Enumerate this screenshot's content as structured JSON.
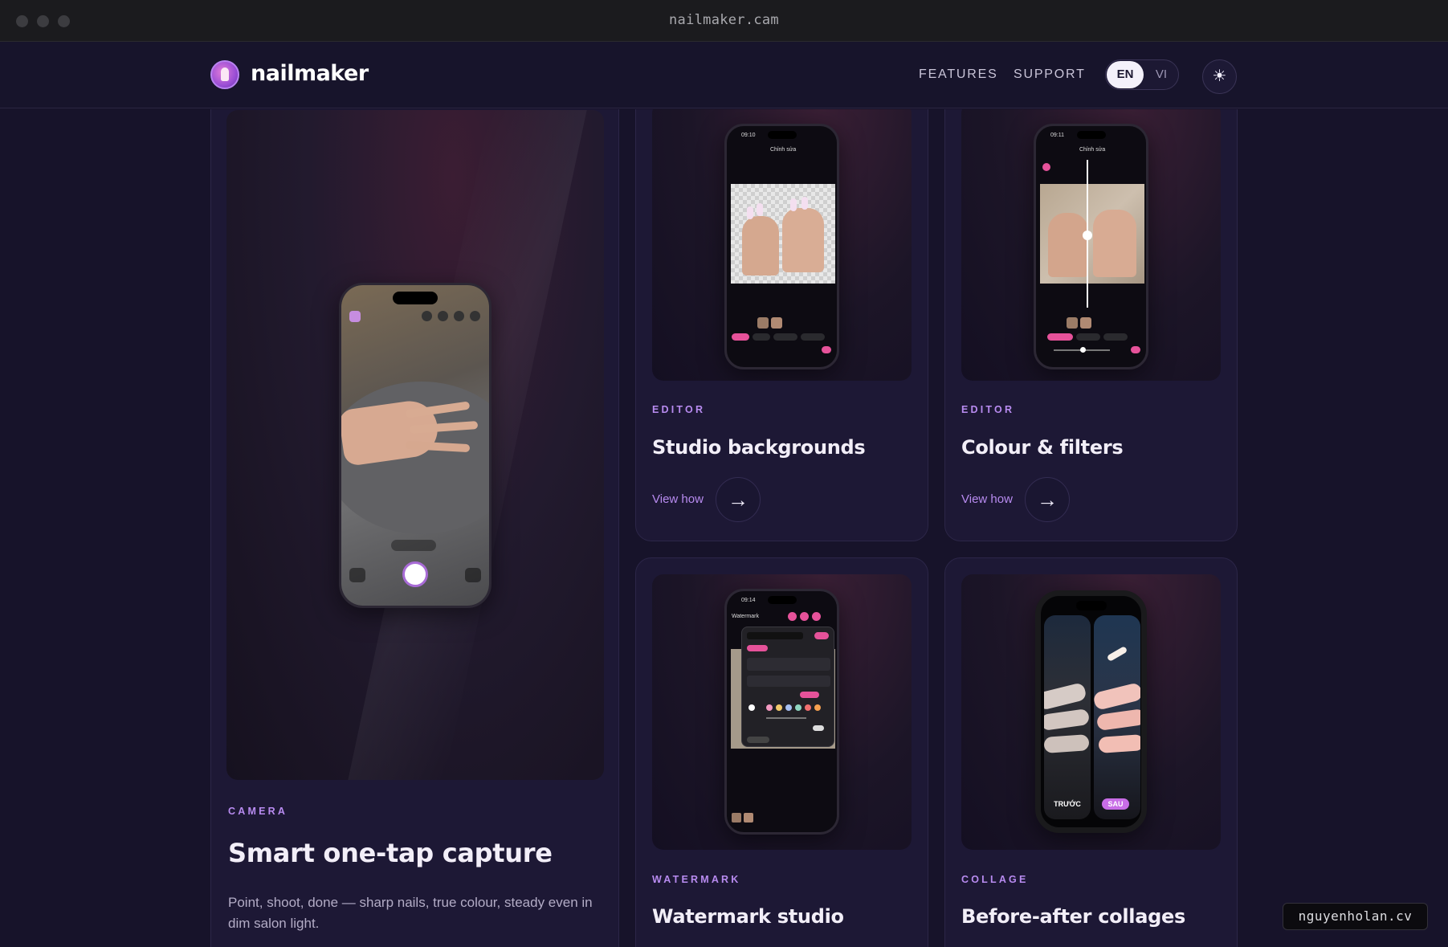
{
  "window": {
    "url": "nailmaker.cam"
  },
  "header": {
    "brand": "nailmaker",
    "nav": [
      {
        "label": "FEATURES"
      },
      {
        "label": "SUPPORT"
      }
    ],
    "lang": {
      "active": "EN",
      "other": "VI"
    },
    "theme_icon": "sun-icon"
  },
  "cards": [
    {
      "tag": "CAMERA",
      "title": "Smart one-tap capture",
      "desc": "Point, shoot, done — sharp nails, true colour, steady even in dim salon light."
    },
    {
      "tag": "EDITOR",
      "title": "Studio backgrounds",
      "cta": "View how"
    },
    {
      "tag": "EDITOR",
      "title": "Colour & filters",
      "cta": "View how"
    },
    {
      "tag": "WATERMARK",
      "title": "Watermark studio"
    },
    {
      "tag": "COLLAGE",
      "title": "Before-after collages"
    }
  ],
  "phones": {
    "editor_title": "Chỉnh sửa",
    "watermark_title": "Watermark",
    "collage_before": "TRƯỚC",
    "collage_after": "SAU",
    "time_1": "09:10",
    "time_2": "09:11",
    "time_3": "09:14"
  },
  "credit": "nguyenholan.cv",
  "colors": {
    "accent": "#b88bf0",
    "background": "#17132a",
    "card": "#1d1835"
  }
}
